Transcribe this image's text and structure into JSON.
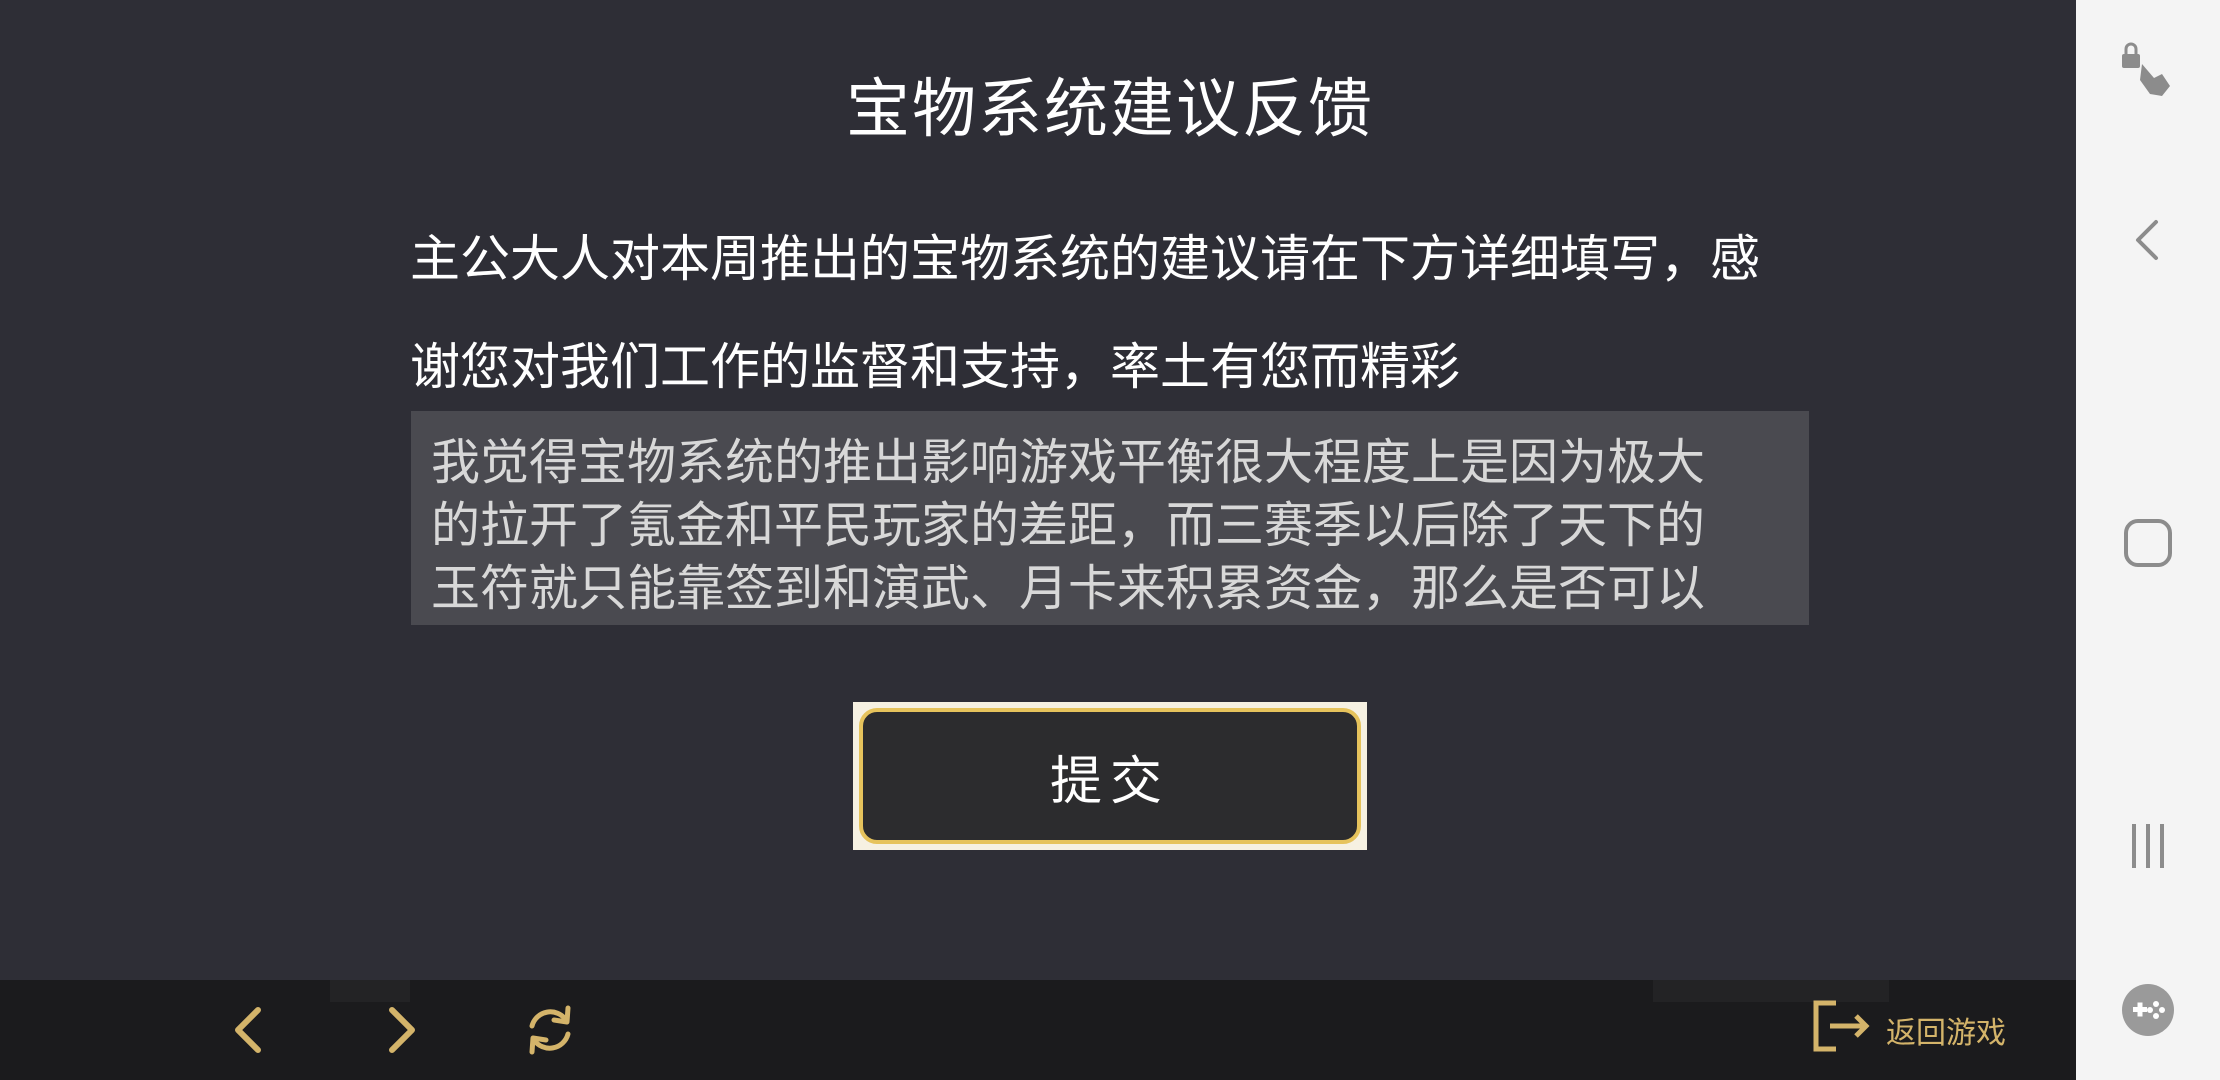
{
  "page": {
    "title": "宝物系统建议反馈",
    "description_line1": "主公大人对本周推出的宝物系统的建议请在下方详细填写，感",
    "description_line2": "谢您对我们工作的监督和支持，率土有您而精彩",
    "feedback_text_line1": "我觉得宝物系统的推出影响游戏平衡很大程度上是因为极大",
    "feedback_text_line2": "的拉开了氪金和平民玩家的差距，而三赛季以后除了天下的",
    "feedback_text_line3": "玉符就只能靠签到和演武、月卡来积累资金，那么是否可以",
    "submit_label": "提交"
  },
  "bottom_bar": {
    "back_icon": "chevron-left-icon",
    "forward_icon": "chevron-right-icon",
    "refresh_icon": "refresh-icon",
    "return_label": "返回游戏",
    "return_icon": "exit-icon"
  },
  "system_sidebar": {
    "icons": [
      "touch-lock-icon",
      "back-icon",
      "home-icon",
      "recents-icon",
      "game-tools-icon"
    ]
  },
  "colors": {
    "background": "#2e2e36",
    "accent_gold": "#e6c35c",
    "textarea_bg": "#4a4a50",
    "bottom_bar": "#1b1b1d",
    "sidebar": "#f4f4f4"
  }
}
